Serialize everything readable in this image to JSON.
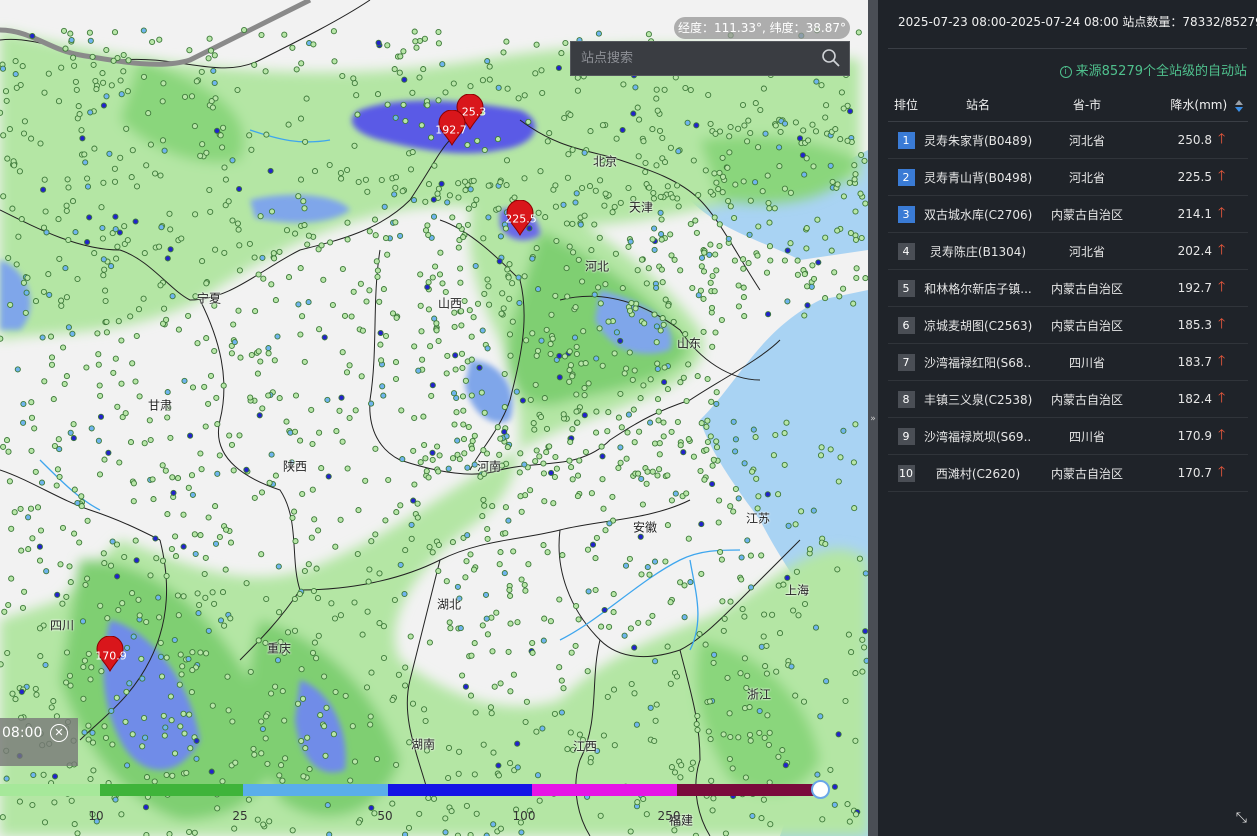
{
  "map": {
    "coord_readout": "经度：111.33°, 纬度：38.87°",
    "search_placeholder": "站点搜索",
    "labels": [
      {
        "name": "北京",
        "id": "beijing"
      },
      {
        "name": "天津",
        "id": "tianjin"
      },
      {
        "name": "河北",
        "id": "hebei"
      },
      {
        "name": "山西",
        "id": "shanxi"
      },
      {
        "name": "山东",
        "id": "shandong"
      },
      {
        "name": "宁夏",
        "id": "ningxia"
      },
      {
        "name": "甘肃",
        "id": "gansu"
      },
      {
        "name": "陕西",
        "id": "shaanxi"
      },
      {
        "name": "河南",
        "id": "henan"
      },
      {
        "name": "安徽",
        "id": "anhui"
      },
      {
        "name": "江苏",
        "id": "jiangsu"
      },
      {
        "name": "上海",
        "id": "shanghai"
      },
      {
        "name": "湖北",
        "id": "hubei"
      },
      {
        "name": "四川",
        "id": "sichuan"
      },
      {
        "name": "重庆",
        "id": "chongqing"
      },
      {
        "name": "浙江",
        "id": "zhejiang"
      },
      {
        "name": "湖南",
        "id": "hunan"
      },
      {
        "name": "江西",
        "id": "jiangxi"
      },
      {
        "name": "福建",
        "id": "fujian"
      }
    ],
    "markers": [
      {
        "label": "25.3"
      },
      {
        "label": "192.7"
      },
      {
        "label": "225.5"
      },
      {
        "label": "170.9"
      }
    ],
    "time_display": "08:00",
    "time_close_icon": "close-circle-icon",
    "legend": {
      "colors": [
        "#a6e89a",
        "#3fb43a",
        "#5aaeea",
        "#1414e6",
        "#e614e6",
        "#7a0a3c"
      ],
      "ticks": [
        "10",
        "25",
        "50",
        "100",
        "250"
      ]
    }
  },
  "panel": {
    "header": "2025-07-23 08:00-2025-07-24 08:00  站点数量：78332/85279",
    "source_note": "来源85279个全站级的自动站",
    "columns": {
      "rank": "排位",
      "name": "站名",
      "province": "省-市",
      "value": "降水(mm)"
    },
    "rows": [
      {
        "rank": "1",
        "name": "灵寿朱家背(B0489)",
        "province": "河北省",
        "value": "250.8"
      },
      {
        "rank": "2",
        "name": "灵寿青山背(B0498)",
        "province": "河北省",
        "value": "225.5"
      },
      {
        "rank": "3",
        "name": "双古城水库(C2706)",
        "province": "内蒙古自治区",
        "value": "214.1"
      },
      {
        "rank": "4",
        "name": "灵寿陈庄(B1304)",
        "province": "河北省",
        "value": "202.4"
      },
      {
        "rank": "5",
        "name": "和林格尔新店子镇...",
        "province": "内蒙古自治区",
        "value": "192.7"
      },
      {
        "rank": "6",
        "name": "凉城麦胡图(C2563)",
        "province": "内蒙古自治区",
        "value": "185.3"
      },
      {
        "rank": "7",
        "name": "沙湾福禄红阳(S68...",
        "province": "四川省",
        "value": "183.7"
      },
      {
        "rank": "8",
        "name": "丰镇三义泉(C2538)",
        "province": "内蒙古自治区",
        "value": "182.4"
      },
      {
        "rank": "9",
        "name": "沙湾福禄岚坝(S69...",
        "province": "四川省",
        "value": "170.9"
      },
      {
        "rank": "10",
        "name": "西滩村(C2620)",
        "province": "内蒙古自治区",
        "value": "170.7"
      }
    ]
  }
}
